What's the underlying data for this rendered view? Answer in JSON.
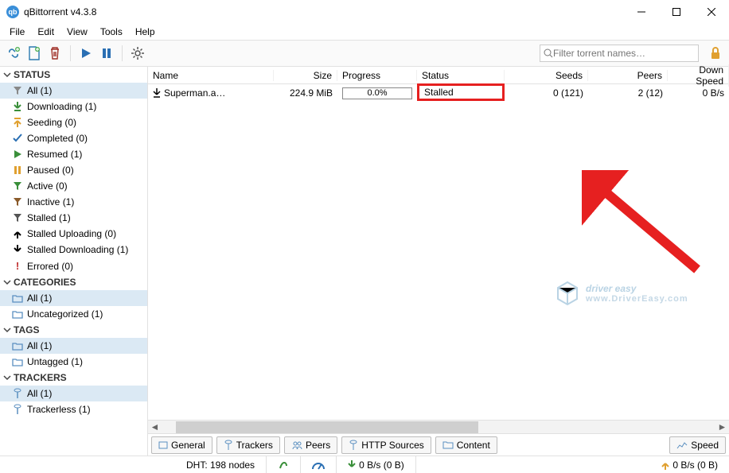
{
  "app": {
    "title": "qBittorrent v4.3.8"
  },
  "menu": [
    "File",
    "Edit",
    "View",
    "Tools",
    "Help"
  ],
  "toolbar": {
    "search_placeholder": "Filter torrent names…"
  },
  "sidebar": {
    "status": {
      "header": "STATUS",
      "items": [
        {
          "icon": "funnel",
          "label": "All (1)",
          "selected": true
        },
        {
          "icon": "dl-green",
          "label": "Downloading (1)"
        },
        {
          "icon": "ul-orange",
          "label": "Seeding (0)"
        },
        {
          "icon": "check",
          "label": "Completed (0)"
        },
        {
          "icon": "play-green",
          "label": "Resumed (1)"
        },
        {
          "icon": "pause-orange",
          "label": "Paused (0)"
        },
        {
          "icon": "funnel-green",
          "label": "Active (0)"
        },
        {
          "icon": "funnel-brown",
          "label": "Inactive (1)"
        },
        {
          "icon": "funnel-gray",
          "label": "Stalled (1)"
        },
        {
          "icon": "up-black",
          "label": "Stalled Uploading (0)"
        },
        {
          "icon": "down-black",
          "label": "Stalled Downloading (1)"
        },
        {
          "icon": "bang-red",
          "label": "Errored (0)"
        }
      ]
    },
    "categories": {
      "header": "CATEGORIES",
      "items": [
        {
          "icon": "folder",
          "label": "All (1)",
          "selected": true
        },
        {
          "icon": "folder",
          "label": "Uncategorized (1)"
        }
      ]
    },
    "tags": {
      "header": "TAGS",
      "items": [
        {
          "icon": "folder",
          "label": "All (1)",
          "selected": true
        },
        {
          "icon": "folder",
          "label": "Untagged (1)"
        }
      ]
    },
    "trackers": {
      "header": "TRACKERS",
      "items": [
        {
          "icon": "tracker",
          "label": "All (1)",
          "selected": true
        },
        {
          "icon": "tracker",
          "label": "Trackerless (1)"
        }
      ]
    }
  },
  "table": {
    "columns": [
      "Name",
      "Size",
      "Progress",
      "Status",
      "Seeds",
      "Peers",
      "Down Speed"
    ],
    "rows": [
      {
        "name": "Superman.a…",
        "size": "224.9 MiB",
        "progress": "0.0%",
        "status": "Stalled",
        "seeds": "0 (121)",
        "peers": "2 (12)",
        "dspeed": "0 B/s"
      }
    ]
  },
  "tabs": [
    "General",
    "Trackers",
    "Peers",
    "HTTP Sources",
    "Content"
  ],
  "speed_tab": "Speed",
  "statusbar": {
    "dht": "DHT: 198 nodes",
    "down": "0 B/s (0 B)",
    "up": "0 B/s (0 B)"
  },
  "watermark": {
    "brand": "driver easy",
    "sub": "www.DriverEasy.com"
  }
}
